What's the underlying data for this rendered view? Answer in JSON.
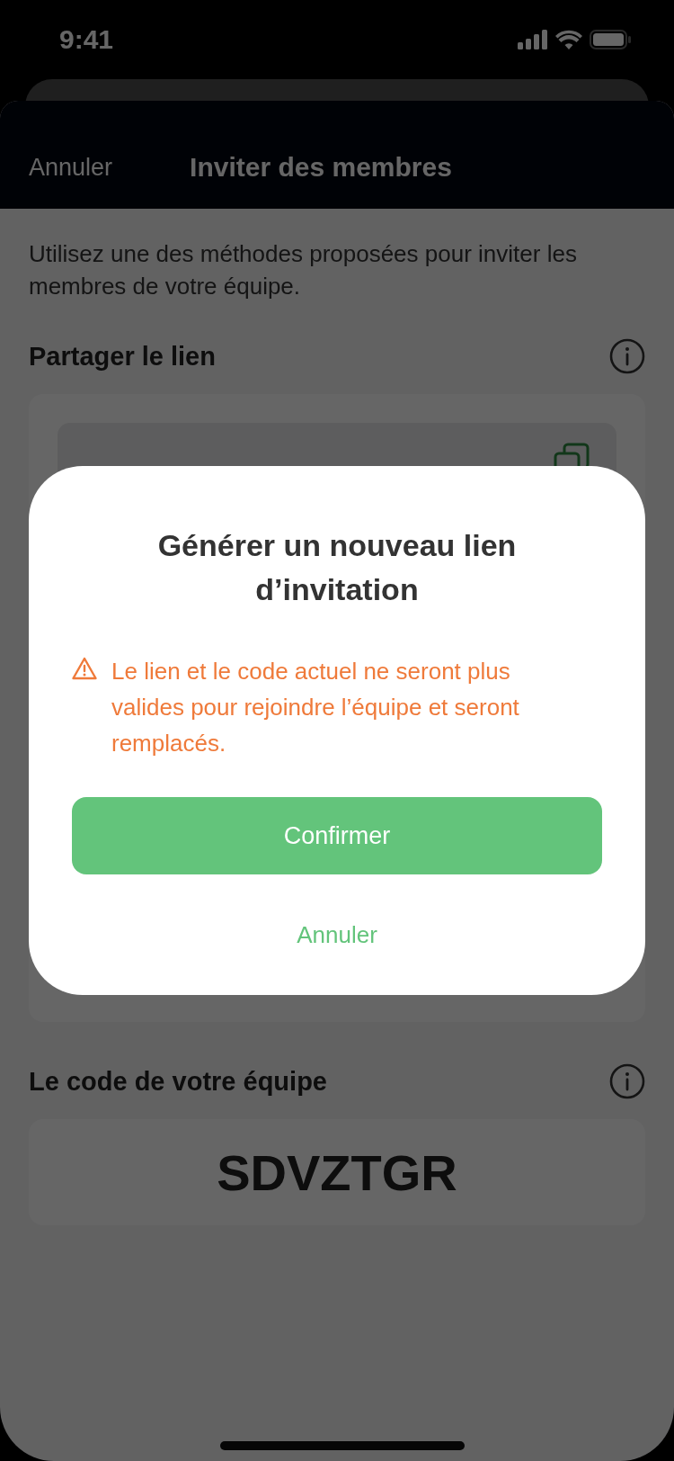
{
  "status_bar": {
    "time": "9:41"
  },
  "header": {
    "cancel": "Annuler",
    "title": "Inviter des membres"
  },
  "intro": "Utilisez une des méthodes proposées pour inviter les membres de votre équipe.",
  "share_section": {
    "title": "Partager le lien"
  },
  "code_section": {
    "title": "Le code de votre équipe",
    "code": "SDVZTGR"
  },
  "dialog": {
    "title": "Générer un nouveau lien d’invitation",
    "warning": "Le lien et le code actuel ne seront plus valides pour rejoindre l’équipe et seront remplacés.",
    "confirm": "Confirmer",
    "cancel": "Annuler"
  }
}
